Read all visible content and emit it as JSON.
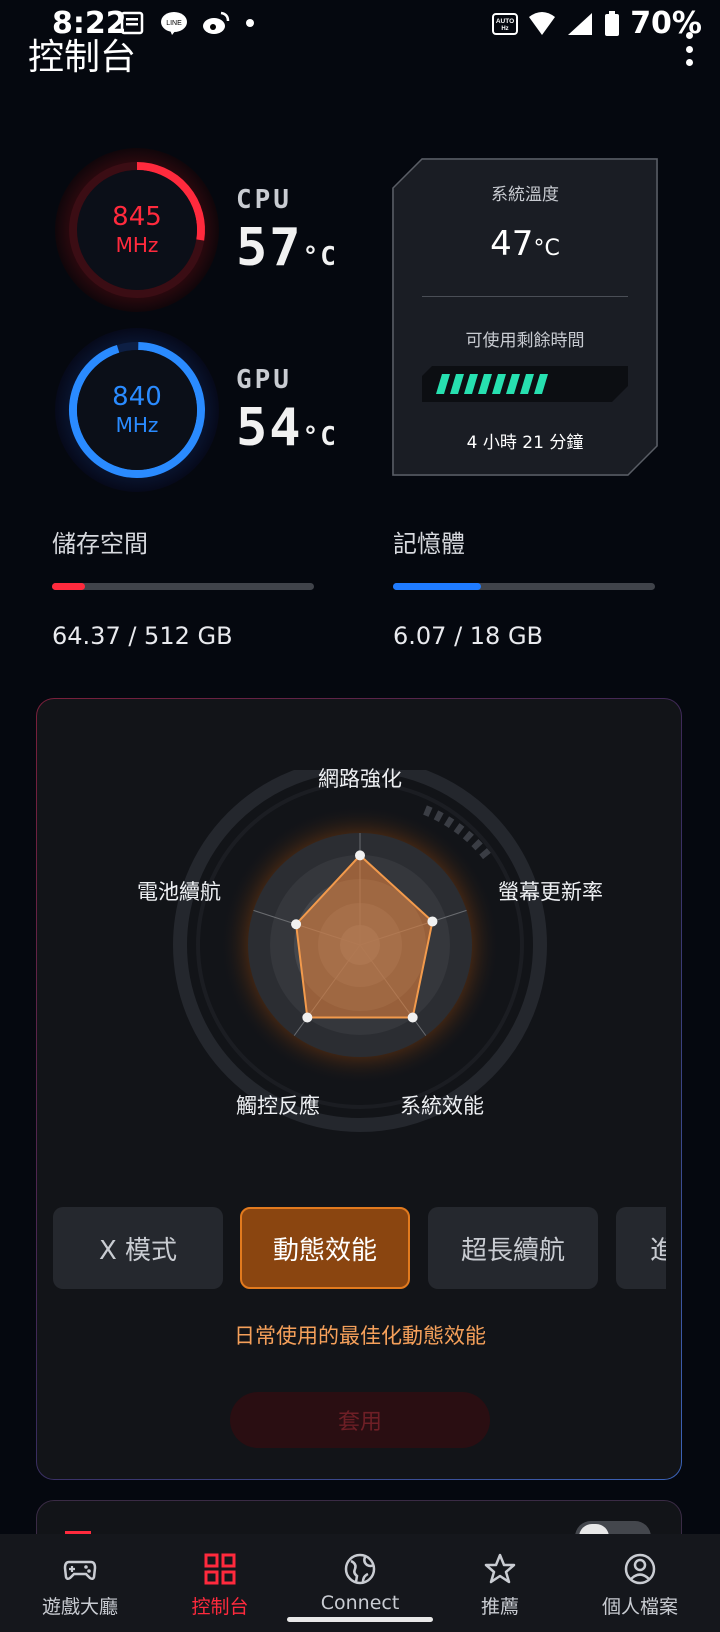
{
  "status_bar": {
    "time": "8:22",
    "battery": "70%",
    "auto_hz": "AUTO Hz"
  },
  "header": {
    "title": "控制台"
  },
  "cpu": {
    "label": "CPU",
    "freq": "845",
    "freq_unit": "MHz",
    "temp": "57",
    "temp_unit": "°C"
  },
  "gpu": {
    "label": "GPU",
    "freq": "840",
    "freq_unit": "MHz",
    "temp": "54",
    "temp_unit": "°C"
  },
  "system_panel": {
    "temp_label": "系統溫度",
    "temp_value": "47",
    "temp_unit": "°C",
    "battery_label": "可使用剩餘時間",
    "battery_level": 0.75,
    "battery_time": "4 小時 21 分鐘"
  },
  "storage": {
    "label": "儲存空間",
    "value": "64.37 / 512 GB",
    "fraction": 0.126,
    "color": "#ff2a3d"
  },
  "memory": {
    "label": "記憶體",
    "value": "6.07 / 18 GB",
    "fraction": 0.337,
    "color": "#1f7bff"
  },
  "radar": {
    "axes": [
      "網路強化",
      "螢幕更新率",
      "系統效能",
      "觸控反應",
      "電池續航"
    ]
  },
  "modes": {
    "items": [
      "X 模式",
      "動態效能",
      "超長續航",
      "進"
    ],
    "active_index": 1,
    "description": "日常使用的最佳化動態效能",
    "apply_label": "套用"
  },
  "bottom_nav": {
    "items": [
      {
        "label": "遊戲大廳",
        "icon": "gamepad-icon"
      },
      {
        "label": "控制台",
        "icon": "console-grid-icon"
      },
      {
        "label": "Connect",
        "icon": "globe-icon"
      },
      {
        "label": "推薦",
        "icon": "star-icon"
      },
      {
        "label": "個人檔案",
        "icon": "profile-icon"
      }
    ],
    "active_index": 1
  },
  "colors": {
    "accent_red": "#ff2a3d",
    "accent_blue": "#2a8bff",
    "accent_orange": "#e27a1e"
  }
}
